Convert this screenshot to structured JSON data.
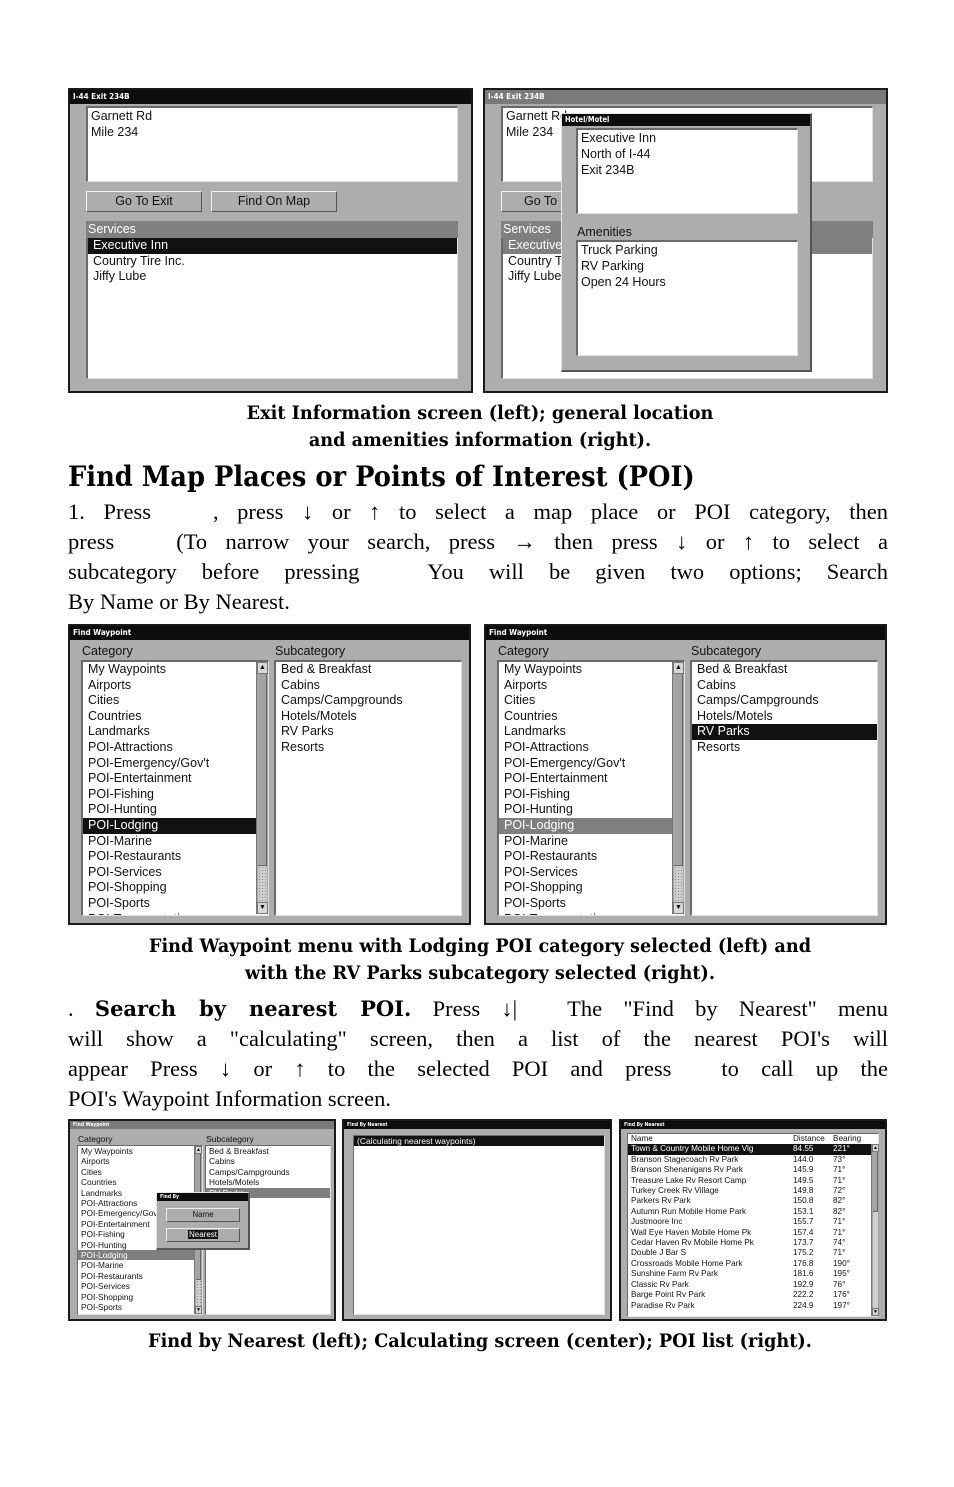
{
  "screens_top": {
    "exit_info": {
      "title": "I-44 Exit 234B",
      "address_lines": [
        "Garnett Rd",
        "Mile 234"
      ],
      "buttons": {
        "go_to_exit": "Go To Exit",
        "find_on_map": "Find On Map"
      },
      "services_header": "Services",
      "services": [
        "Executive Inn",
        "Country Tire Inc.",
        "Jiffy Lube"
      ],
      "selected_index": 0
    },
    "amenities": {
      "title": "I-44 Exit 234B",
      "background_address_lines": [
        "Garnett Rd",
        "Mile 234"
      ],
      "background_button_partial": "Go To",
      "background_services_header": "Services",
      "background_services_partial": [
        "Executive",
        "Country T",
        "Jiffy Lube"
      ],
      "popup": {
        "title": "Hotel/Motel",
        "info_lines": [
          "Executive Inn",
          "North of I-44",
          "Exit 234B"
        ],
        "amenities_label": "Amenities",
        "amenities": [
          "Truck Parking",
          "RV Parking",
          "Open 24 Hours"
        ]
      }
    }
  },
  "caption1": [
    "Exit Information screen (left); general location",
    "and amenities information (right)."
  ],
  "heading": "Find Map Places or Points of Interest (POI)",
  "para1": {
    "lines": [
      [
        "1. Press",
        ", press ↓ or ↑ to select a map place or POI category, then"
      ],
      [
        "press",
        "(To narrow your search, press → then press ↓ or ↑ to select a"
      ],
      [
        "subcategory before pressing",
        "You will be given two options; Search"
      ],
      [
        "By Name or By Nearest."
      ]
    ]
  },
  "find_waypoint": {
    "title": "Find Waypoint",
    "category_label": "Category",
    "subcategory_label": "Subcategory",
    "categories": [
      "My Waypoints",
      "Airports",
      "Cities",
      "Countries",
      "Landmarks",
      "POI-Attractions",
      "POI-Emergency/Gov't",
      "POI-Entertainment",
      "POI-Fishing",
      "POI-Hunting",
      "POI-Lodging",
      "POI-Marine",
      "POI-Restaurants",
      "POI-Services",
      "POI-Shopping",
      "POI-Sports",
      "POI-Transportation"
    ],
    "subcategories": [
      "Bed & Breakfast",
      "Cabins",
      "Camps/Campgrounds",
      "Hotels/Motels",
      "RV Parks",
      "Resorts"
    ],
    "left_selected_category": "POI-Lodging",
    "right_selected_subcategory": "RV Parks",
    "scroll_up_icon": "▲",
    "scroll_down_icon": "▼"
  },
  "caption2": [
    "Find Waypoint menu with Lodging POI category selected (left) and",
    "with the RV Parks subcategory selected (right)."
  ],
  "para2": {
    "prefix": ". ",
    "bold": "Search by nearest POI.",
    "lines": [
      [
        "Press ↓|",
        "The \"Find by Nearest\" menu"
      ],
      [
        "will show a \"calculating\" screen, then a list of the nearest POI's will"
      ],
      [
        "appear  Press ↓ or ↑ to the selected POI and press",
        "to call up the"
      ],
      [
        "POI's Waypoint Information screen."
      ]
    ]
  },
  "find_by": {
    "title": "Find By",
    "options": [
      "Name",
      "Nearest"
    ],
    "selected": "Nearest"
  },
  "calculating": {
    "title": "Find By Nearest",
    "message": "(Calculating nearest waypoints)"
  },
  "poi_list": {
    "title": "Find By Nearest",
    "columns": [
      "Name",
      "Distance",
      "Bearing"
    ],
    "rows": [
      [
        "Town & Country Mobile Home Vlg",
        "84.55",
        "221°"
      ],
      [
        "Branson Stagecoach Rv Park",
        "144.0",
        "73°"
      ],
      [
        "Branson Shenanigans Rv Park",
        "145.9",
        "71°"
      ],
      [
        "Treasure Lake Rv Resort Camp",
        "149.5",
        "71°"
      ],
      [
        "Turkey Creek Rv Village",
        "149.8",
        "72°"
      ],
      [
        "Parkers Rv Park",
        "150.8",
        "82°"
      ],
      [
        "Autumn Run Mobile Home Park",
        "153.1",
        "82°"
      ],
      [
        "Justmoore Inc",
        "155.7",
        "71°"
      ],
      [
        "Wall Eye Haven Mobile Home Pk",
        "157.4",
        "71°"
      ],
      [
        "Cedar Haven Rv Mobile Home Pk",
        "173.7",
        "74°"
      ],
      [
        "Double J Bar S",
        "175.2",
        "71°"
      ],
      [
        "Crossroads Mobile Home Park",
        "176.8",
        "190°"
      ],
      [
        "Sunshine Farm Rv Park",
        "181.6",
        "195°"
      ],
      [
        "Classic Rv Park",
        "192.9",
        "76°"
      ],
      [
        "Barge Point Rv Park",
        "222.2",
        "176°"
      ],
      [
        "Paradise Rv Park",
        "224.9",
        "197°"
      ]
    ],
    "selected_index": 0
  },
  "caption3": "Find by Nearest (left); Calculating screen (center); POI list (right).",
  "colors": {
    "screen_bg": "#adadad",
    "selection_black": "#111111",
    "selection_grey": "#7f7f7f",
    "header_grey": "#808080"
  }
}
